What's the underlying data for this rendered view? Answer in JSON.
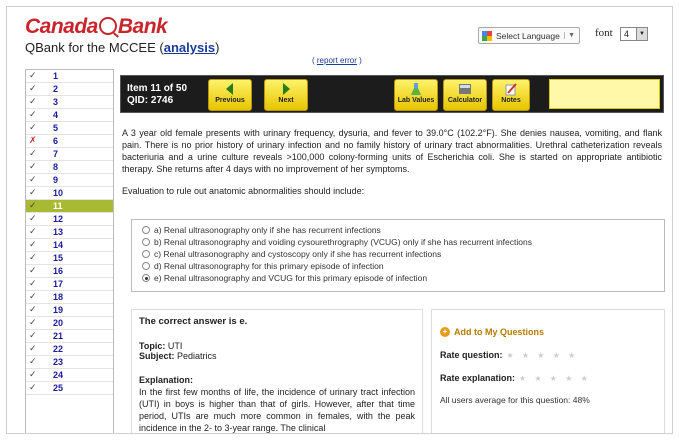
{
  "header": {
    "logo_left": "Canada",
    "logo_right": "Bank",
    "subtitle_prefix": "QBank for the MCCEE",
    "analysis_link": "analysis",
    "report_error": "report error",
    "language_select": "Select Language",
    "font_label": "font",
    "font_value": "4"
  },
  "sidebar": {
    "items": [
      {
        "num": "1",
        "mark": "✓"
      },
      {
        "num": "2",
        "mark": "✓"
      },
      {
        "num": "3",
        "mark": "✓"
      },
      {
        "num": "4",
        "mark": "✓"
      },
      {
        "num": "5",
        "mark": "✓"
      },
      {
        "num": "6",
        "mark": "✗"
      },
      {
        "num": "7",
        "mark": "✓"
      },
      {
        "num": "8",
        "mark": "✓"
      },
      {
        "num": "9",
        "mark": "✓"
      },
      {
        "num": "10",
        "mark": "✓"
      },
      {
        "num": "11",
        "mark": "✓"
      },
      {
        "num": "12",
        "mark": "✓"
      },
      {
        "num": "13",
        "mark": "✓"
      },
      {
        "num": "14",
        "mark": "✓"
      },
      {
        "num": "15",
        "mark": "✓"
      },
      {
        "num": "16",
        "mark": "✓"
      },
      {
        "num": "17",
        "mark": "✓"
      },
      {
        "num": "18",
        "mark": "✓"
      },
      {
        "num": "19",
        "mark": "✓"
      },
      {
        "num": "20",
        "mark": "✓"
      },
      {
        "num": "21",
        "mark": "✓"
      },
      {
        "num": "22",
        "mark": "✓"
      },
      {
        "num": "23",
        "mark": "✓"
      },
      {
        "num": "24",
        "mark": "✓"
      },
      {
        "num": "25",
        "mark": "✓"
      }
    ],
    "current": "11"
  },
  "toolbar": {
    "item_line": "Item 11 of 50",
    "qid_line": "QID: 2746",
    "previous": "Previous",
    "next": "Next",
    "lab_values": "Lab Values",
    "calculator": "Calculator",
    "notes": "Notes"
  },
  "question": {
    "stem": "A 3 year old female presents with urinary frequency, dysuria, and fever to 39.0°C (102.2°F). She denies nausea, vomiting, and flank pain. There is no prior history of urinary infection and no family history of urinary tract abnormalities. Urethral catheterization reveals bacteriuria and a urine culture reveals >100,000 colony-forming units of Escherichia coli. She is started on appropriate antibiotic therapy. She returns after 4 days with no improvement of her symptoms.",
    "prompt": "Evaluation to rule out anatomic abnormalities should include:",
    "options": [
      "a)  Renal ultrasonography only if she has recurrent infections",
      "b)  Renal ultrasonography and voiding cysourethrography (VCUG) only if she has recurrent infections",
      "c)  Renal ultrasonography and cystoscopy only if she has recurrent infections",
      "d)  Renal ultrasonography for this primary episode of infection",
      "e)  Renal ultrasonography and VCUG for this primary episode of infection"
    ],
    "selected": 4
  },
  "explanation": {
    "correct": "The correct answer is e.",
    "topic_label": "Topic:",
    "topic": "UTI",
    "subject_label": "Subject:",
    "subject": "Pediatrics",
    "expl_label": "Explanation:",
    "body": "In the first few months of life, the incidence of urinary tract infection (UTI) in boys is higher than that of girls. However, after that time period, UTIs are much more common in females, with the peak incidence in the 2- to 3-year range. The clinical"
  },
  "side": {
    "add": "Add to My Questions",
    "rate_question": "Rate question:",
    "rate_explanation": "Rate explanation:",
    "stars": "★ ★ ★ ★ ★",
    "average": "All users average for this question: 48%"
  }
}
